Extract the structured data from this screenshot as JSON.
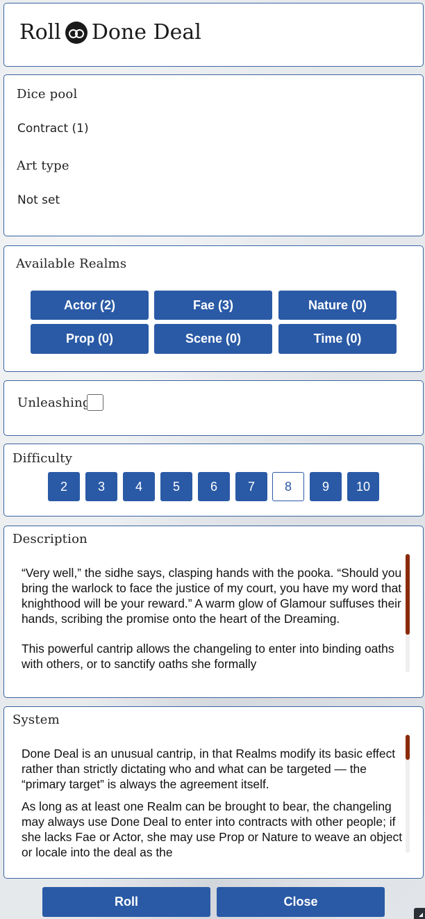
{
  "header": {
    "title_prefix": "Roll",
    "title_suffix": "Done Deal"
  },
  "dice_pool": {
    "heading": "Dice pool",
    "value": "Contract (1)"
  },
  "art_type": {
    "heading": "Art type",
    "value": "Not set"
  },
  "realms": {
    "heading": "Available Realms",
    "buttons": [
      "Actor (2)",
      "Fae (3)",
      "Nature (0)",
      "Prop (0)",
      "Scene (0)",
      "Time (0)"
    ]
  },
  "unleashing": {
    "label": "Unleashing",
    "checked": false
  },
  "difficulty": {
    "heading": "Difficulty",
    "options": [
      "2",
      "3",
      "4",
      "5",
      "6",
      "7",
      "8",
      "9",
      "10"
    ],
    "selected": "8"
  },
  "description": {
    "heading": "Description",
    "paragraphs": [
      "“Very well,” the sidhe says, clasping hands with the pooka. “Should you bring the warlock to face the justice of my court, you have my word that knighthood will be your reward.” A warm glow of Glamour suffuses their hands, scribing the promise onto the heart of the Dreaming.",
      "This powerful cantrip allows the changeling to enter into binding oaths with others, or to sanctify oaths she formally"
    ]
  },
  "system": {
    "heading": "System",
    "paragraphs": [
      "Done Deal is an unusual cantrip, in that Realms modify its basic effect rather than strictly dictating who and what can be targeted — the “primary target” is always the agreement itself.",
      "As long as at least one Realm can be brought to bear, the changeling may always use Done Deal to enter into contracts with other people; if she lacks Fae or Actor, she may use Prop or Nature to weave an object or locale into the deal as the"
    ]
  },
  "actions": {
    "roll": "Roll",
    "close": "Close"
  },
  "colors": {
    "accent": "#2a5aa6",
    "scrollbar": "#8a2a0a",
    "border": "#3a64a0"
  }
}
